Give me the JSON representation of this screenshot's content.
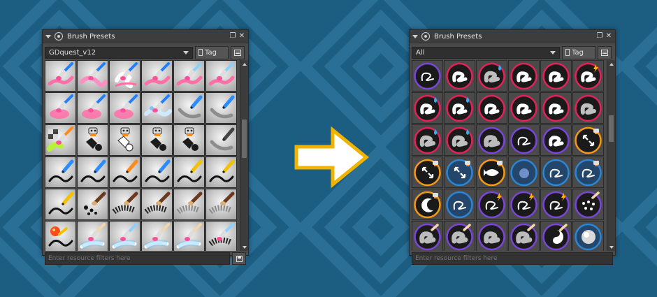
{
  "colors": {
    "desktop_bg": "#1c5d82",
    "pattern_light": "#2a6f96",
    "arrow_fill": "#ffffff",
    "arrow_stroke": "#f0b400",
    "ring_pink": "#e2235a",
    "ring_purple": "#7b46d6",
    "ring_orange": "#f59a12",
    "ring_blue": "#2a86d6"
  },
  "arrow": {
    "icon": "right-arrow-icon"
  },
  "left_panel": {
    "title": "Brush Presets",
    "combo_value": "GDquest_v12",
    "tag_label": "Tag",
    "filter_placeholder": "Enter resource filters here",
    "scroll": {
      "thumb_fraction": 0.22,
      "position_fraction": 0.38
    },
    "presets": [
      {
        "tip": "airbrush-pink",
        "tool": "pink-brush"
      },
      {
        "tip": "eraser-pink",
        "tool": "pink-brush"
      },
      {
        "tip": "smudge-pink",
        "tool": "pink-brush"
      },
      {
        "tip": "airbrush-pink",
        "tool": "pink-brush"
      },
      {
        "tip": "airbrush-pink",
        "tool": "blue-brush"
      },
      {
        "tip": "airbrush-pink",
        "tool": "blue-brush"
      },
      {
        "tip": "soft-pink",
        "tool": "pink-brush"
      },
      {
        "tip": "soft-pink",
        "tool": "pink-brush"
      },
      {
        "tip": "soft-pink",
        "tool": "pink-brush"
      },
      {
        "tip": "splash-blue",
        "tool": "pink-brush"
      },
      {
        "tip": "grey-stroke",
        "tool": "blue-pencil"
      },
      {
        "tip": "grey-stroke",
        "tool": "blue-pencil"
      },
      {
        "tip": "checker-green",
        "tool": "orange-brush"
      },
      {
        "tip": "shape-black",
        "tool": "robot"
      },
      {
        "tip": "shape-white",
        "tool": "robot"
      },
      {
        "tip": "shape-black",
        "tool": "robot"
      },
      {
        "tip": "shape-black",
        "tool": "robot"
      },
      {
        "tip": "grey-stroke",
        "tool": "dark-pencil"
      },
      {
        "tip": "ink-stroke",
        "tool": "blue-pencil"
      },
      {
        "tip": "ink-stroke",
        "tool": "blue-pencil"
      },
      {
        "tip": "ink-stroke",
        "tool": "orange-pencil"
      },
      {
        "tip": "ink-stroke",
        "tool": "blue-pencil"
      },
      {
        "tip": "ink-stroke",
        "tool": "yellow-pencil"
      },
      {
        "tip": "ink-stroke",
        "tool": "yellow-pencil"
      },
      {
        "tip": "ink-stroke",
        "tool": "yellow-pencil"
      },
      {
        "tip": "dots-black",
        "tool": "charcoal"
      },
      {
        "tip": "texture-dark",
        "tool": "charcoal"
      },
      {
        "tip": "texture-dark",
        "tool": "charcoal"
      },
      {
        "tip": "texture-grey",
        "tool": "charcoal"
      },
      {
        "tip": "texture-grey",
        "tool": "charcoal"
      },
      {
        "tip": "ink-stroke",
        "tool": "ball-orange"
      },
      {
        "tip": "glow-blue",
        "tool": "cream-brush"
      },
      {
        "tip": "glow-blue",
        "tool": "blue-brush"
      },
      {
        "tip": "glow-blue",
        "tool": "cream-brush"
      },
      {
        "tip": "glow-blue",
        "tool": "cream-brush"
      },
      {
        "tip": "texture-dark",
        "tool": "blue-brush"
      }
    ]
  },
  "right_panel": {
    "title": "Brush Presets",
    "combo_value": "All",
    "tag_label": "Tag",
    "filter_placeholder": "Enter resource filters here",
    "scroll": {
      "thumb_fraction": 0.15,
      "position_fraction": 0.32
    },
    "presets": [
      {
        "ring": "purple",
        "glyph": "s-thin",
        "badge": ""
      },
      {
        "ring": "pink",
        "glyph": "s-thick",
        "badge": ""
      },
      {
        "ring": "pink",
        "glyph": "s-soft",
        "badge": "drop"
      },
      {
        "ring": "pink",
        "glyph": "s-thick",
        "badge": ""
      },
      {
        "ring": "pink",
        "glyph": "s-thick",
        "badge": ""
      },
      {
        "ring": "pink",
        "glyph": "s-thick",
        "badge": "bolt"
      },
      {
        "ring": "pink",
        "glyph": "s-thick",
        "badge": "drop"
      },
      {
        "ring": "pink",
        "glyph": "s-thick",
        "badge": "drop"
      },
      {
        "ring": "pink",
        "glyph": "s-thick",
        "badge": ""
      },
      {
        "ring": "pink",
        "glyph": "s-thick",
        "badge": ""
      },
      {
        "ring": "pink",
        "glyph": "s-thick",
        "badge": ""
      },
      {
        "ring": "pink",
        "glyph": "s-soft",
        "badge": ""
      },
      {
        "ring": "pink",
        "glyph": "s-soft",
        "badge": "drop"
      },
      {
        "ring": "pink",
        "glyph": "s-soft",
        "badge": "drop"
      },
      {
        "ring": "purple",
        "glyph": "s-grain",
        "badge": ""
      },
      {
        "ring": "purple",
        "glyph": "s-thin",
        "badge": ""
      },
      {
        "ring": "purple",
        "glyph": "s-thick",
        "badge": ""
      },
      {
        "ring": "orange",
        "glyph": "arrows",
        "badge": "robot"
      },
      {
        "ring": "orange",
        "glyph": "arrows",
        "badge": "robot"
      },
      {
        "ring": "blue",
        "glyph": "arrows",
        "badge": "robot"
      },
      {
        "ring": "orange",
        "glyph": "fish",
        "badge": "robot"
      },
      {
        "ring": "blue",
        "glyph": "dot",
        "badge": ""
      },
      {
        "ring": "blue",
        "glyph": "s-thin",
        "badge": ""
      },
      {
        "ring": "blue",
        "glyph": "s-thin",
        "badge": "robot"
      },
      {
        "ring": "orange",
        "glyph": "moon",
        "badge": "robot"
      },
      {
        "ring": "blue",
        "glyph": "s-thin",
        "badge": ""
      },
      {
        "ring": "purple",
        "glyph": "s-thin",
        "badge": "bolt"
      },
      {
        "ring": "purple",
        "glyph": "s-thin",
        "badge": "bolt"
      },
      {
        "ring": "purple",
        "glyph": "s-thin",
        "badge": "bolt"
      },
      {
        "ring": "purple",
        "glyph": "dots",
        "badge": "cream"
      },
      {
        "ring": "purple",
        "glyph": "s-grain",
        "badge": "cream"
      },
      {
        "ring": "purple",
        "glyph": "s-grain",
        "badge": "cream"
      },
      {
        "ring": "purple",
        "glyph": "s-grain",
        "badge": ""
      },
      {
        "ring": "purple",
        "glyph": "s-grain",
        "badge": "cream"
      },
      {
        "ring": "purple",
        "glyph": "yin",
        "badge": "cream"
      },
      {
        "ring": "blue",
        "glyph": "sphere",
        "badge": ""
      }
    ]
  }
}
